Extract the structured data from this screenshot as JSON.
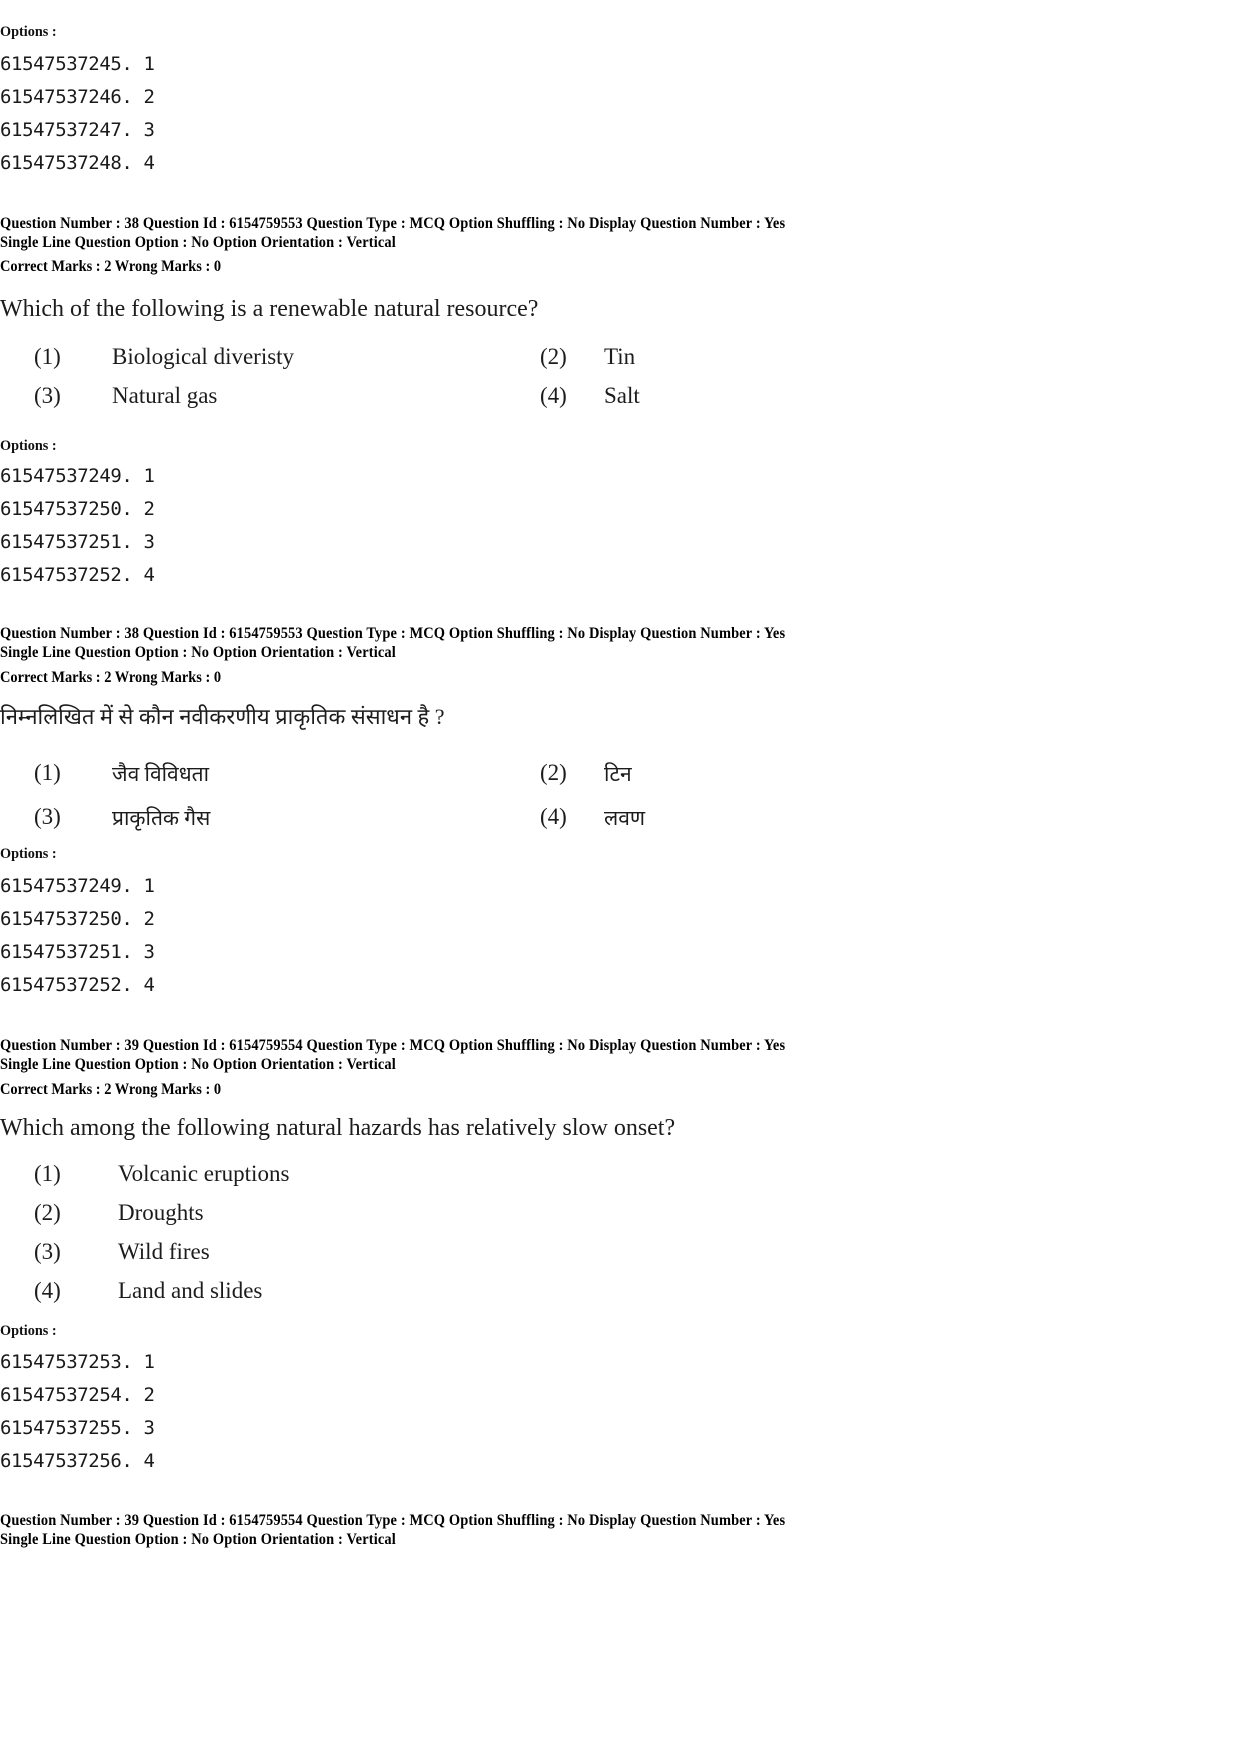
{
  "document": {
    "type": "exam-answer-key-page",
    "labels": {
      "options": "Options :",
      "question_number": "Question Number :",
      "question_id": "Question Id :",
      "question_type": "Question Type :",
      "option_shuffling": "Option Shuffling :",
      "display_question_number": "Display Question Number :",
      "single_line_question_option": "Single Line Question Option :",
      "option_orientation": "Option Orientation :",
      "correct_marks": "Correct Marks :",
      "wrong_marks": "Wrong Marks :"
    }
  },
  "blocks": {
    "top_options": {
      "label": "Options :",
      "ids": [
        "61547537245. 1",
        "61547537246. 2",
        "61547537247. 3",
        "61547537248. 4"
      ]
    },
    "q38_en": {
      "meta_line1": "Question Number : 38  Question Id : 6154759553  Question Type : MCQ  Option Shuffling : No  Display Question Number : Yes",
      "meta_line2": "Single Line Question Option : No  Option Orientation : Vertical",
      "marks_line": "Correct Marks : 2  Wrong Marks : 0",
      "question_number": "38",
      "question_id": "6154759553",
      "question_type": "MCQ",
      "option_shuffling": "No",
      "display_question_number": "Yes",
      "single_line_question_option": "No",
      "option_orientation": "Vertical",
      "correct_marks": "2",
      "wrong_marks": "0",
      "stem": "Which of the following is a renewable natural resource?",
      "choices": [
        {
          "num": "(1)",
          "text": "Biological diveristy"
        },
        {
          "num": "(2)",
          "text": "Tin"
        },
        {
          "num": "(3)",
          "text": "Natural gas"
        },
        {
          "num": "(4)",
          "text": "Salt"
        }
      ],
      "options_label": "Options :",
      "option_ids": [
        "61547537249. 1",
        "61547537250. 2",
        "61547537251. 3",
        "61547537252. 4"
      ]
    },
    "q38_hi": {
      "meta_line1": "Question Number : 38  Question Id : 6154759553  Question Type : MCQ  Option Shuffling : No  Display Question Number : Yes",
      "meta_line2": "Single Line Question Option : No  Option Orientation : Vertical",
      "marks_line": "Correct Marks : 2  Wrong Marks : 0",
      "question_number": "38",
      "question_id": "6154759553",
      "question_type": "MCQ",
      "option_shuffling": "No",
      "display_question_number": "Yes",
      "single_line_question_option": "No",
      "option_orientation": "Vertical",
      "correct_marks": "2",
      "wrong_marks": "0",
      "stem": "निम्नलिखित में से कौन नवीकरणीय प्राकृतिक संसाधन है ?",
      "choices": [
        {
          "num": "(1)",
          "text": "जैव विविधता"
        },
        {
          "num": "(2)",
          "text": "टिन"
        },
        {
          "num": "(3)",
          "text": "प्राकृतिक गैस"
        },
        {
          "num": "(4)",
          "text": "लवण"
        }
      ],
      "options_label": "Options :",
      "option_ids": [
        "61547537249. 1",
        "61547537250. 2",
        "61547537251. 3",
        "61547537252. 4"
      ]
    },
    "q39_en": {
      "meta_line1": "Question Number : 39  Question Id : 6154759554  Question Type : MCQ  Option Shuffling : No  Display Question Number : Yes",
      "meta_line2": "Single Line Question Option : No  Option Orientation : Vertical",
      "marks_line": "Correct Marks : 2  Wrong Marks : 0",
      "question_number": "39",
      "question_id": "6154759554",
      "question_type": "MCQ",
      "option_shuffling": "No",
      "display_question_number": "Yes",
      "single_line_question_option": "No",
      "option_orientation": "Vertical",
      "correct_marks": "2",
      "wrong_marks": "0",
      "stem": "Which among the following natural hazards has relatively slow onset?",
      "choices": [
        {
          "num": "(1)",
          "text": "Volcanic eruptions"
        },
        {
          "num": "(2)",
          "text": "Droughts"
        },
        {
          "num": "(3)",
          "text": "Wild fires"
        },
        {
          "num": "(4)",
          "text": "Land and slides"
        }
      ],
      "options_label": "Options :",
      "option_ids": [
        "61547537253. 1",
        "61547537254. 2",
        "61547537255. 3",
        "61547537256. 4"
      ]
    },
    "q39_hi_partial": {
      "meta_line1": "Question Number : 39  Question Id : 6154759554  Question Type : MCQ  Option Shuffling : No  Display Question Number : Yes",
      "meta_line2": "Single Line Question Option : No  Option Orientation : Vertical",
      "question_number": "39",
      "question_id": "6154759554",
      "question_type": "MCQ",
      "option_shuffling": "No",
      "display_question_number": "Yes",
      "single_line_question_option": "No",
      "option_orientation": "Vertical"
    }
  }
}
